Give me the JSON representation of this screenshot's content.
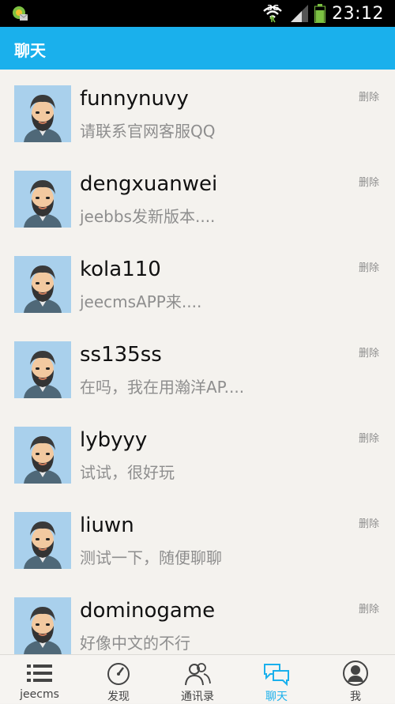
{
  "status_bar": {
    "network": "3G",
    "time": "23:12"
  },
  "header": {
    "title": "聊天"
  },
  "chats": [
    {
      "name": "funnynuvy",
      "preview": "请联系官网客服QQ",
      "delete_label": "删除"
    },
    {
      "name": "dengxuanwei",
      "preview": "jeebbs发新版本....",
      "delete_label": "删除"
    },
    {
      "name": "kola110",
      "preview": "jeecmsAPP来....",
      "delete_label": "删除"
    },
    {
      "name": "ss135ss",
      "preview": "在吗，我在用瀚洋AP....",
      "delete_label": "删除"
    },
    {
      "name": "lybyyy",
      "preview": "试试，很好玩",
      "delete_label": "删除"
    },
    {
      "name": "liuwn",
      "preview": "测试一下，随便聊聊",
      "delete_label": "删除"
    },
    {
      "name": "dominogame",
      "preview": "好像中文的不行",
      "delete_label": "删除"
    }
  ],
  "tabs": [
    {
      "label": "jeecms",
      "icon": "list-icon"
    },
    {
      "label": "发现",
      "icon": "compass-icon"
    },
    {
      "label": "通讯录",
      "icon": "contacts-icon"
    },
    {
      "label": "聊天",
      "icon": "chat-bubbles-icon",
      "active": true
    },
    {
      "label": "我",
      "icon": "profile-icon"
    }
  ],
  "colors": {
    "accent": "#1ab0ec",
    "background": "#f4f2ee",
    "avatar_bg": "#a9d0ec"
  }
}
